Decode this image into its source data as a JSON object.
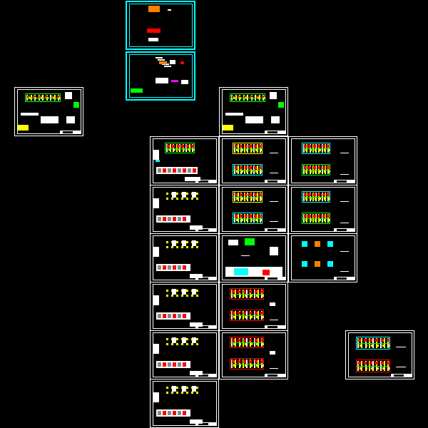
{
  "drawing": {
    "background": "#000000",
    "colors": {
      "frame": "#ffffff",
      "frame_cover": "#00ffff",
      "wall": "#00ffff",
      "column": "#ffff00",
      "dimension": "#00ff00",
      "rebar": "#ff0000",
      "highlight": "#ff8000",
      "accent": "#ff00ff"
    }
  }
}
